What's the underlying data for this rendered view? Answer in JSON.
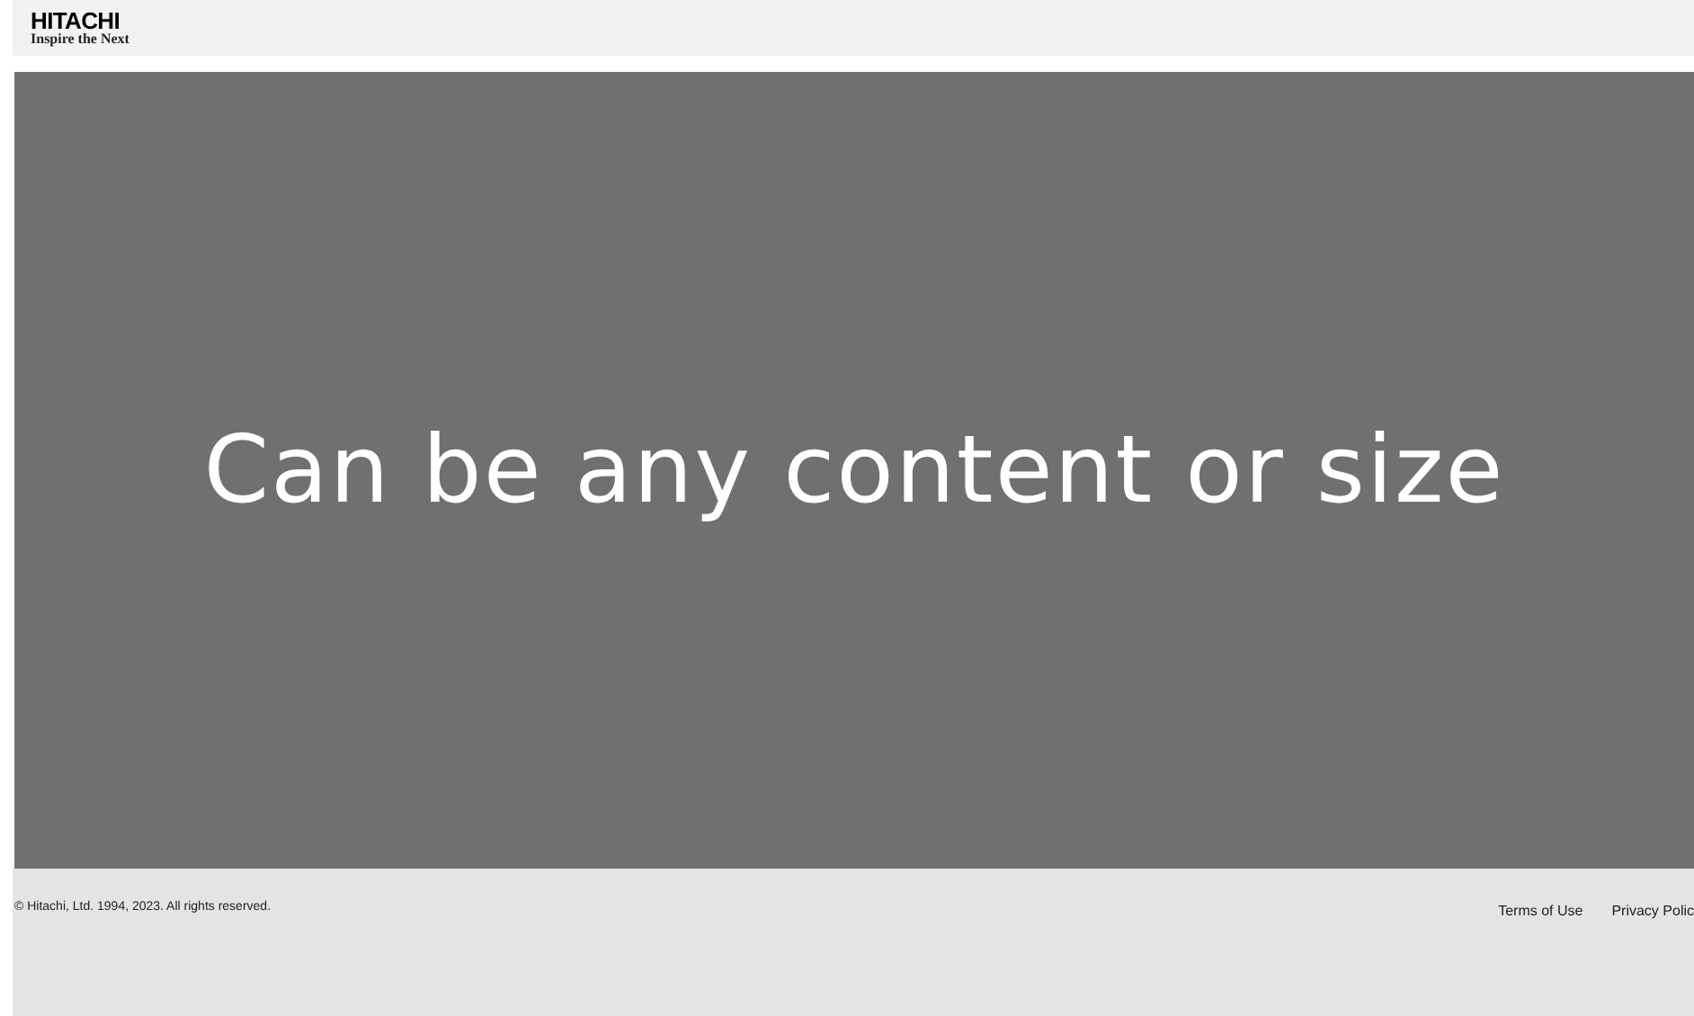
{
  "header": {
    "logo_name": "HITACHI",
    "logo_tagline": "Inspire the Next"
  },
  "content": {
    "text": "Can be any content or size"
  },
  "footer": {
    "copyright": "© Hitachi, Ltd. 1994, 2023. All rights reserved.",
    "links": [
      "Terms of Use",
      "Privacy Polic"
    ]
  }
}
